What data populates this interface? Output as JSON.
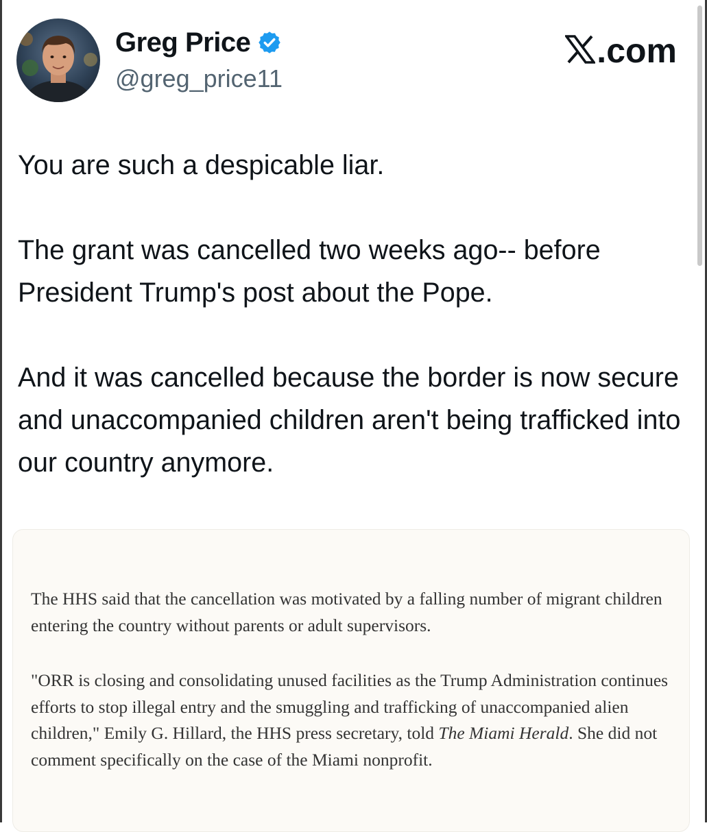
{
  "author": {
    "display_name": "Greg Price",
    "handle": "@greg_price11",
    "verified": true
  },
  "brand": {
    "label": ".com",
    "icon": "x-logo-icon"
  },
  "tweet": {
    "paragraphs": [
      "You are such a despicable liar.",
      "The grant was cancelled two weeks ago-- before President Trump's post about the Pope.",
      "And it was cancelled because the border is now secure and unaccompanied children aren't being trafficked into our country anymore."
    ]
  },
  "quote": {
    "paragraph1": "The HHS said that the cancellation was motivated by a falling number of migrant children entering the country without parents or adult supervisors.",
    "paragraph2_before": "\"ORR is closing and consolidating unused facilities as the Trump Administration continues efforts to stop illegal entry and the smuggling and trafficking of unaccompanied alien children,\" Emily G. Hillard, the HHS press secretary, told ",
    "paragraph2_italic": "The Miami Herald",
    "paragraph2_after": ". She did not comment specifically on the case of the Miami nonprofit."
  },
  "colors": {
    "verified_badge": "#1d9bf0",
    "text_primary": "#0f1419",
    "text_secondary": "#536471",
    "quote_background": "#fcfaf6"
  }
}
